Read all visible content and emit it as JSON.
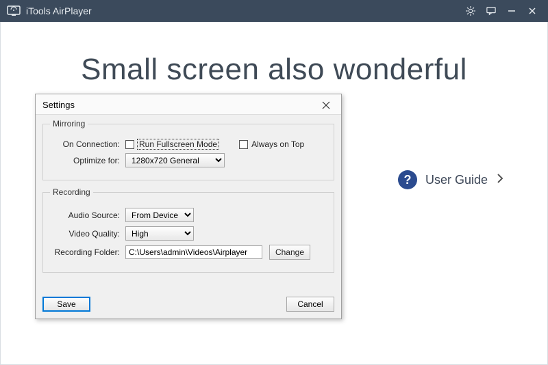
{
  "app": {
    "title": "iTools AirPlayer"
  },
  "main": {
    "headline": "Small screen also wonderful",
    "user_guide_label": "User Guide"
  },
  "dialog": {
    "title": "Settings",
    "mirroring": {
      "legend": "Mirroring",
      "on_connection_label": "On Connection:",
      "fullscreen_label": "Run Fullscreen Mode",
      "always_top_label": "Always on Top",
      "optimize_label": "Optimize for:",
      "optimize_value": "1280x720 General"
    },
    "recording": {
      "legend": "Recording",
      "audio_label": "Audio Source:",
      "audio_value": "From Device",
      "video_label": "Video Quality:",
      "video_value": "High",
      "folder_label": "Recording Folder:",
      "folder_value": "C:\\Users\\admin\\Videos\\Airplayer",
      "change_label": "Change"
    },
    "save_label": "Save",
    "cancel_label": "Cancel"
  }
}
